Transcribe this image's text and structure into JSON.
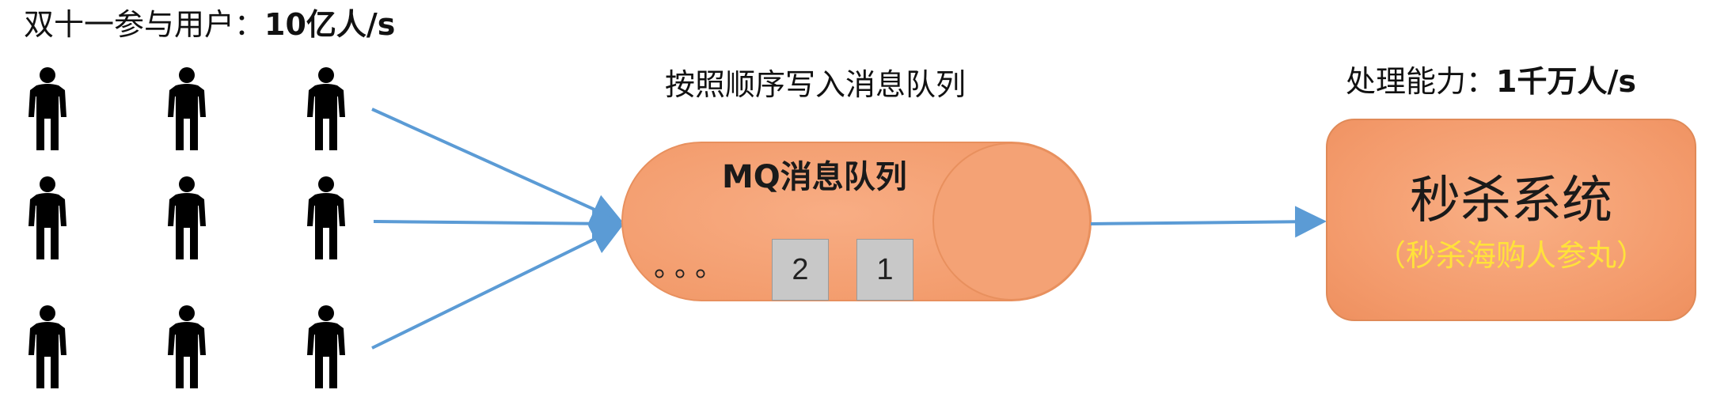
{
  "users": {
    "title_prefix": "双十一参与用户：",
    "title_value": "10亿人/s",
    "icon": "person-icon",
    "rows": 3,
    "cols": 3
  },
  "queue": {
    "write_label": "按照顺序写入消息队列",
    "label": "MQ消息队列",
    "dots": "。。。",
    "cells": [
      "2",
      "1"
    ]
  },
  "system": {
    "capacity_prefix": "处理能力：",
    "capacity_value": "1千万人/s",
    "title": "秒杀系统",
    "subtitle": "（秒杀海购人参丸）"
  },
  "colors": {
    "queue_fill": "#f4a275",
    "queue_stroke": "#e8905e",
    "arrow": "#5b9bd5",
    "subtitle": "#ffe23a",
    "cell_fill": "#c8c8c8"
  }
}
